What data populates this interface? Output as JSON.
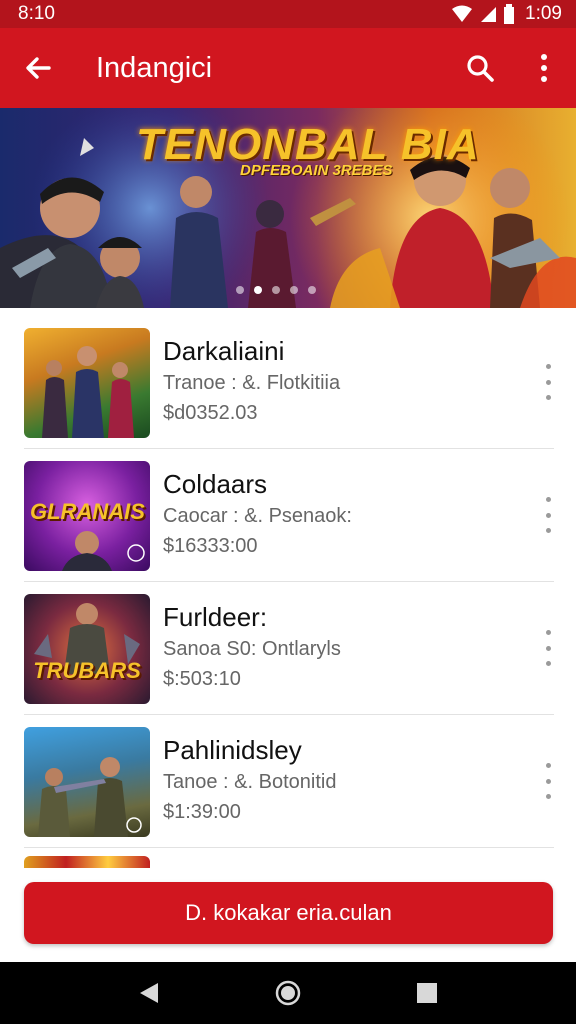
{
  "status_bar": {
    "time": "8:10",
    "clock_right": "1:09"
  },
  "app_bar": {
    "title": "Indangici",
    "icons": [
      "back-arrow-icon",
      "search-icon",
      "more-vert-icon"
    ]
  },
  "banner": {
    "title": "TENONBAL BIA",
    "subtitle": "DPFEBOAIN 3REBES",
    "page_count": 5,
    "active_page": 2
  },
  "games": [
    {
      "title": "Darkaliaini",
      "subtitle": "Tranoe : &. Flotkitiia",
      "price": "$d0352.03",
      "thumb_text": ""
    },
    {
      "title": "Coldaars",
      "subtitle": "Caocar : &. Psenaok:",
      "price": "$16333:00",
      "thumb_text": "GLRANAIS"
    },
    {
      "title": "Furldeer:",
      "subtitle": "Sanoa S0: Ontlaryls",
      "price": "$:503:10",
      "thumb_text": "TRUBARS"
    },
    {
      "title": "Pahlinidsley",
      "subtitle": "Tanoe : &. Botonitid",
      "price": "$1:39:00",
      "thumb_text": ""
    }
  ],
  "cta": {
    "label": "D. kokakar eria.culan"
  },
  "colors": {
    "primary": "#d1161f",
    "status": "#b3141c"
  }
}
